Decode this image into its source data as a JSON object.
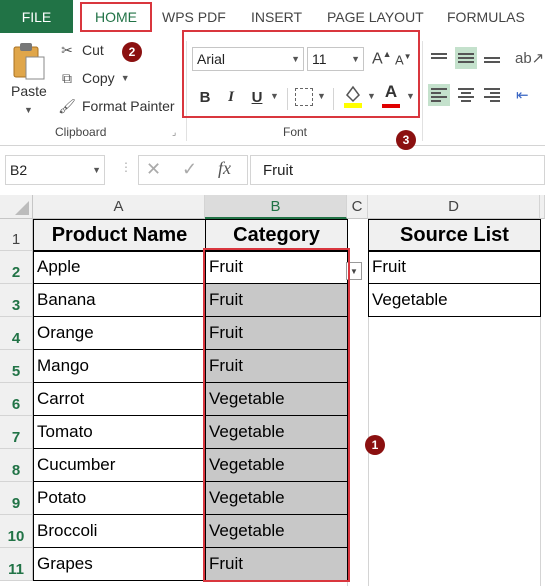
{
  "tabs": {
    "file": "FILE",
    "home": "HOME",
    "wps_pdf": "WPS PDF",
    "insert": "INSERT",
    "page_layout": "PAGE LAYOUT",
    "formulas": "FORMULAS"
  },
  "clipboard": {
    "paste": "Paste",
    "cut": "Cut",
    "copy": "Copy",
    "format_painter": "Format Painter",
    "group_label": "Clipboard"
  },
  "font": {
    "font_name": "Arial",
    "font_size": "11",
    "group_label": "Font",
    "bold": "B",
    "italic": "I",
    "underline": "U",
    "grow": "A",
    "shrink": "A",
    "font_color_glyph": "A"
  },
  "callouts": {
    "one": "1",
    "two": "2",
    "three": "3"
  },
  "formula_bar": {
    "name_box": "B2",
    "fx": "fx",
    "content": "Fruit"
  },
  "columns": [
    "A",
    "B",
    "C",
    "D"
  ],
  "rows": [
    "1",
    "2",
    "3",
    "4",
    "5",
    "6",
    "7",
    "8",
    "9",
    "10",
    "11"
  ],
  "sheet": {
    "header_a": "Product Name",
    "header_b": "Category",
    "header_d": "Source List",
    "products": [
      "Apple",
      "Banana",
      "Orange",
      "Mango",
      "Carrot",
      "Tomato",
      "Cucumber",
      "Potato",
      "Broccoli",
      "Grapes"
    ],
    "categories": [
      "Fruit",
      "Fruit",
      "Fruit",
      "Fruit",
      "Vegetable",
      "Vegetable",
      "Vegetable",
      "Vegetable",
      "Vegetable",
      "Fruit"
    ],
    "source_list": [
      "Fruit",
      "Vegetable"
    ]
  },
  "colors": {
    "excel_green": "#217346",
    "highlight_red": "#d9363e",
    "badge": "#8b1010",
    "selection_grey": "#c8c8c8"
  }
}
